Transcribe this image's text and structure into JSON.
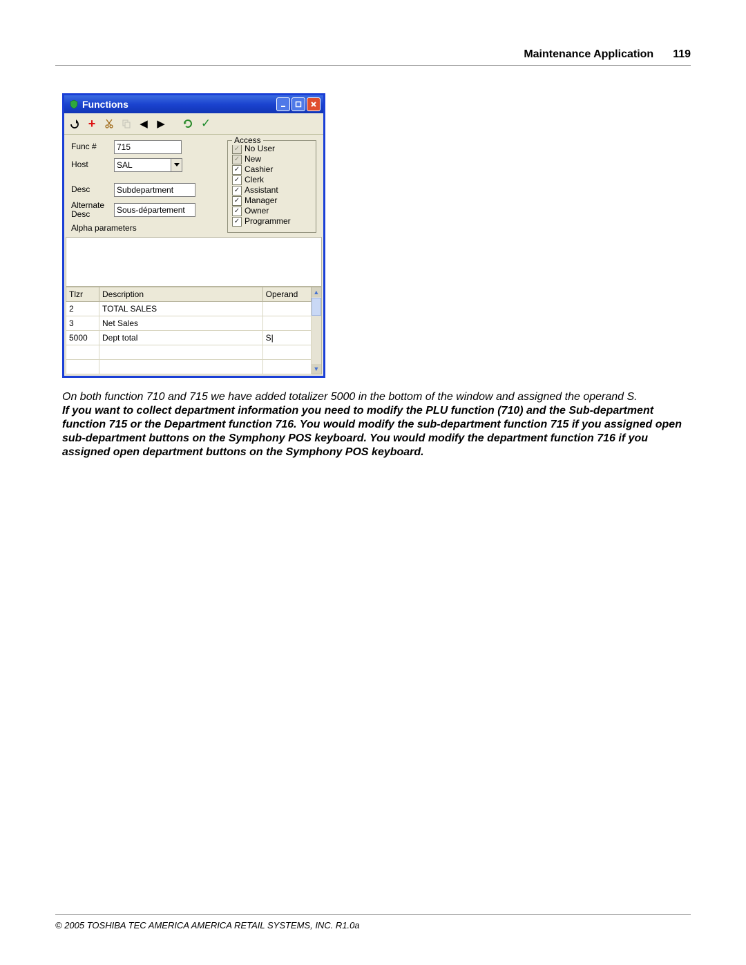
{
  "header": {
    "section": "Maintenance Application",
    "page_number": "119"
  },
  "window": {
    "title": "Functions",
    "toolbar_icons": [
      "undo",
      "add",
      "cut",
      "copy",
      "prev",
      "next",
      "refresh",
      "ok"
    ],
    "fields": {
      "func_label": "Func #",
      "func_value": "715",
      "host_label": "Host",
      "host_value": "SAL",
      "desc_label": "Desc",
      "desc_value": "Subdepartment",
      "altdesc_label": "Alternate\nDesc",
      "altdesc_value": "Sous-département",
      "alpha_label": "Alpha parameters"
    },
    "access": {
      "legend": "Access",
      "items": [
        {
          "label": "No User",
          "checked": true,
          "disabled": true
        },
        {
          "label": "New",
          "checked": true,
          "disabled": true
        },
        {
          "label": "Cashier",
          "checked": true,
          "disabled": false
        },
        {
          "label": "Clerk",
          "checked": true,
          "disabled": false
        },
        {
          "label": "Assistant",
          "checked": true,
          "disabled": false
        },
        {
          "label": "Manager",
          "checked": true,
          "disabled": false
        },
        {
          "label": "Owner",
          "checked": true,
          "disabled": false
        },
        {
          "label": "Programmer",
          "checked": true,
          "disabled": false
        }
      ]
    },
    "table": {
      "columns": [
        "Tlzr",
        "Description",
        "Operand"
      ],
      "rows": [
        {
          "tlzr": "2",
          "desc": "TOTAL SALES",
          "operand": ""
        },
        {
          "tlzr": "3",
          "desc": "Net Sales",
          "operand": ""
        },
        {
          "tlzr": "5000",
          "desc": "Dept total",
          "operand": "S|"
        },
        {
          "tlzr": "",
          "desc": "",
          "operand": ""
        },
        {
          "tlzr": "",
          "desc": "",
          "operand": ""
        }
      ]
    }
  },
  "body": {
    "caption": "On both function 710 and 715 we have added  totalizer 5000 in the bottom of the window and assigned the operand S.",
    "para2": "If you want to collect department information you need to modify the PLU function (710) and the Sub-department function 715 or the Department function 716. You would modify the sub-department function 715 if you assigned open sub-department buttons on the Symphony POS keyboard. You would modify the department function 716 if you assigned open department buttons on the Symphony POS keyboard."
  },
  "footer": "© 2005 TOSHIBA TEC AMERICA AMERICA RETAIL SYSTEMS, INC.   R1.0a"
}
